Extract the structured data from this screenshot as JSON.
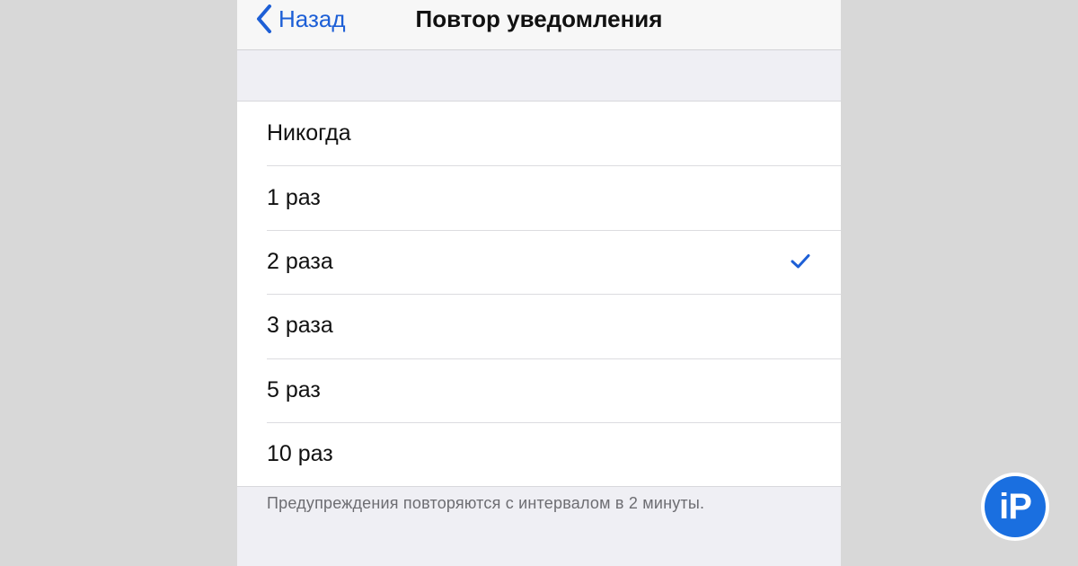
{
  "navbar": {
    "back_label": "Назад",
    "title": "Повтор уведомления"
  },
  "options": [
    {
      "label": "Никогда",
      "selected": false
    },
    {
      "label": "1 раз",
      "selected": false
    },
    {
      "label": "2 раза",
      "selected": true
    },
    {
      "label": "3 раза",
      "selected": false
    },
    {
      "label": "5 раз",
      "selected": false
    },
    {
      "label": "10 раз",
      "selected": false
    }
  ],
  "footer_note": "Предупреждения повторяются с интервалом в 2 минуты.",
  "logo_text": "iP",
  "colors": {
    "accent": "#1d5fd6",
    "logo_blue": "#1a6fe0",
    "background": "#efeff4"
  },
  "icons": {
    "back": "chevron-left-icon",
    "selected": "checkmark-icon"
  }
}
